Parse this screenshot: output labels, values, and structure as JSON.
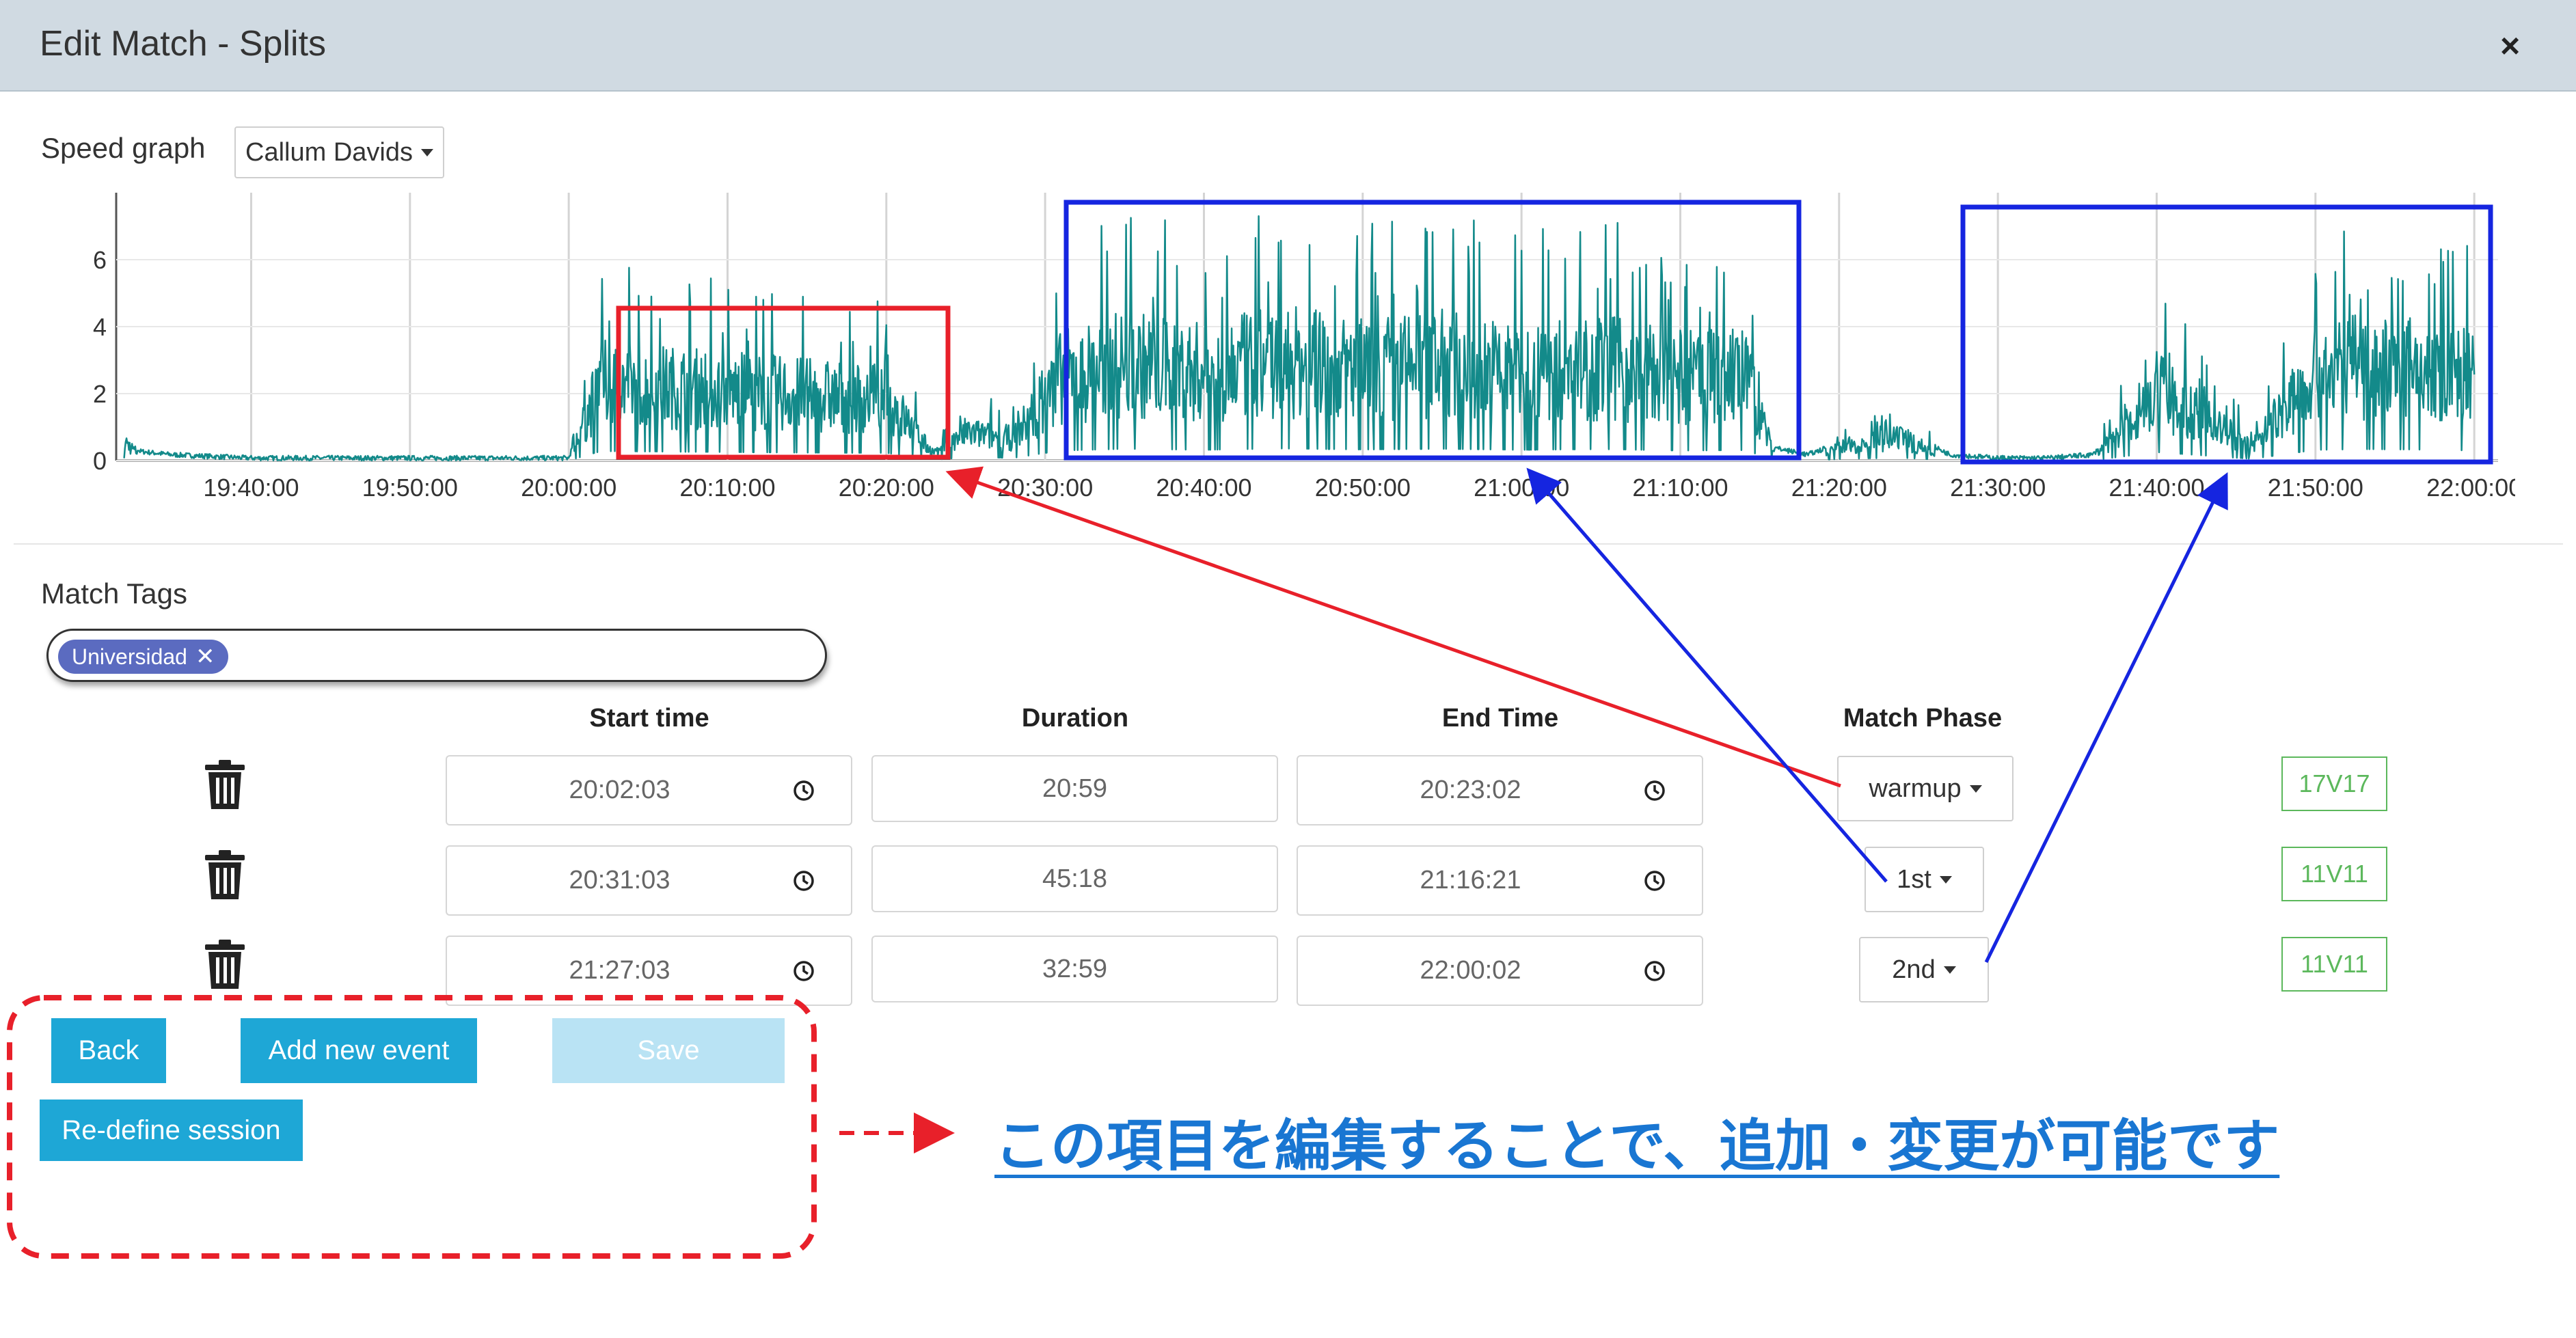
{
  "modal": {
    "title": "Edit Match - Splits",
    "close_glyph": "×"
  },
  "speed_graph": {
    "label": "Speed graph",
    "player_selected": "Callum Davids"
  },
  "chart_data": {
    "type": "line",
    "ylim": [
      0,
      8
    ],
    "xlim": [
      "19:31:30",
      "22:01:30"
    ],
    "x_ticks": [
      "19:40:00",
      "19:50:00",
      "20:00:00",
      "20:10:00",
      "20:20:00",
      "20:30:00",
      "20:40:00",
      "20:50:00",
      "21:00:00",
      "21:10:00",
      "21:20:00",
      "21:30:00",
      "21:40:00",
      "21:50:00",
      "22:00:00"
    ],
    "y_ticks": [
      0,
      2,
      4,
      6
    ],
    "grid": "vertical",
    "line_color": "#138a8a",
    "series": [
      {
        "x": [
          "19:32:00",
          "19:33:00",
          "19:35:00",
          "19:40:00",
          "19:50:00",
          "20:00:00",
          "20:02:00",
          "20:05:00",
          "20:08:00",
          "20:11:00",
          "20:14:00",
          "20:17:00",
          "20:20:00",
          "20:23:00",
          "20:25:00",
          "20:28:00",
          "20:31:00",
          "20:35:00",
          "20:40:00",
          "20:45:00",
          "20:50:00",
          "20:55:00",
          "21:00:00",
          "21:05:00",
          "21:10:00",
          "21:14:00",
          "21:16:00",
          "21:18:00",
          "21:21:00",
          "21:24:00",
          "21:27:00",
          "21:30:00",
          "21:33:00",
          "21:36:00",
          "21:40:00",
          "21:43:00",
          "21:46:00",
          "21:50:00",
          "21:53:00",
          "21:56:00",
          "22:00:00"
        ],
        "values": [
          0.7,
          0.2,
          0.1,
          0.0,
          0.0,
          0.0,
          2.8,
          2.7,
          2.6,
          2.5,
          2.4,
          2.3,
          2.3,
          0.2,
          1.0,
          0.8,
          3.0,
          3.5,
          3.2,
          3.6,
          3.3,
          3.5,
          3.2,
          3.4,
          3.0,
          3.1,
          0.3,
          0.1,
          0.6,
          0.8,
          0.1,
          0.0,
          0.0,
          0.1,
          2.5,
          1.5,
          0.5,
          3.2,
          3.4,
          3.3,
          3.0
        ]
      }
    ]
  },
  "match_tags": {
    "label": "Match Tags",
    "chips": [
      "Universidad"
    ],
    "remove_glyph": "✕"
  },
  "splits": {
    "headers": {
      "start_time": "Start time",
      "duration": "Duration",
      "end_time": "End Time",
      "match_phase": "Match Phase"
    },
    "rows": [
      {
        "start": "20:02:03",
        "duration": "20:59",
        "end": "20:23:02",
        "phase": "warmup",
        "badge": "17V17"
      },
      {
        "start": "20:31:03",
        "duration": "45:18",
        "end": "21:16:21",
        "phase": "1st",
        "badge": "11V11"
      },
      {
        "start": "21:27:03",
        "duration": "32:59",
        "end": "22:00:02",
        "phase": "2nd",
        "badge": "11V11"
      }
    ]
  },
  "buttons": {
    "back": "Back",
    "add_event": "Add new event",
    "save": "Save",
    "redefine": "Re-define session"
  },
  "annotation": {
    "note": "この項目を編集することで、追加・変更が可能です",
    "colors": {
      "red": "#e8202a",
      "blue": "#1525e0"
    }
  },
  "icons": {
    "trash": "trash-icon",
    "clock": "clock-icon",
    "caret": "caret-down-icon",
    "close": "close-icon"
  }
}
